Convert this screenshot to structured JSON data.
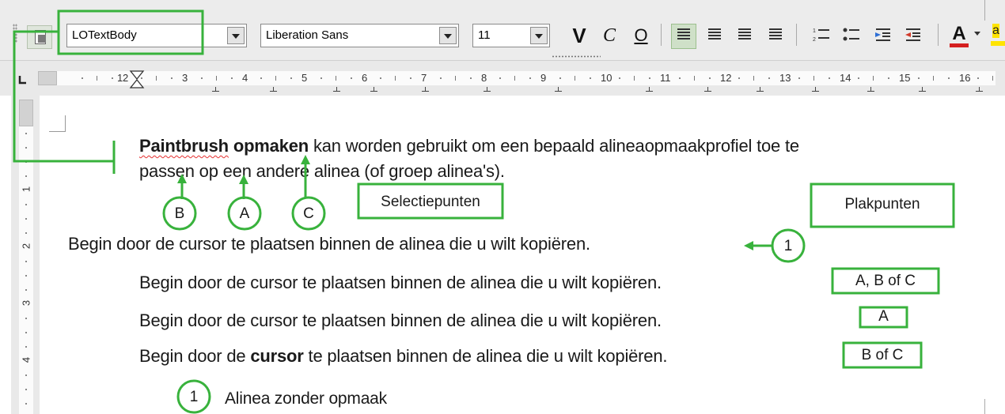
{
  "toolbar": {
    "paragraph_style": "LOTextBody",
    "font_name": "Liberation Sans",
    "font_size": "11",
    "bold_label": "V",
    "italic_label": "C",
    "underline_label": "O",
    "font_color_label": "A",
    "highlight_label": "a"
  },
  "ruler": {
    "numbers": [
      "1",
      "2",
      "3",
      "4",
      "5",
      "6",
      "7",
      "8",
      "9",
      "10",
      "11",
      "12",
      "13",
      "14",
      "15",
      "16"
    ],
    "vertical_numbers": [
      "1",
      "2",
      "3",
      "4"
    ]
  },
  "document": {
    "para1": {
      "bold1": "Paintbrush",
      "bold2": "opmaken",
      "line1_rest": "kan worden gebruikt om een bepaald alineaopmaakprofiel toe te",
      "line2": "passen op een andere alinea (of groep alinea's)."
    },
    "line_begin": "Begin door de cursor te plaatsen binnen de alinea die u wilt kopiëren.",
    "line_indent1": "Begin door de cursor te plaatsen binnen de alinea die u wilt kopiëren.",
    "line_indent2": "Begin door de cursor te plaatsen binnen de alinea die u wilt kopiëren.",
    "line_indent3": {
      "pre": "Begin door de",
      "bold": "cursor",
      "post": "te plaatsen binnen de alinea die u wilt kopiëren."
    },
    "legend": "Alinea zonder opmaak"
  },
  "annotations": {
    "circle_b": "B",
    "circle_a": "A",
    "circle_c": "C",
    "selectiepunten": "Selectiepunten",
    "plakpunten": "Plakpunten",
    "circle_1": "1",
    "box_abc": "A, B of C",
    "box_a": "A",
    "box_bc": "B of C",
    "legend_circle": "1"
  },
  "colors": {
    "annotation_green": "#38b23c",
    "toolbar_bg": "#ececec",
    "spellcheck_red": "#e53030",
    "font_color_red": "#d42020"
  }
}
